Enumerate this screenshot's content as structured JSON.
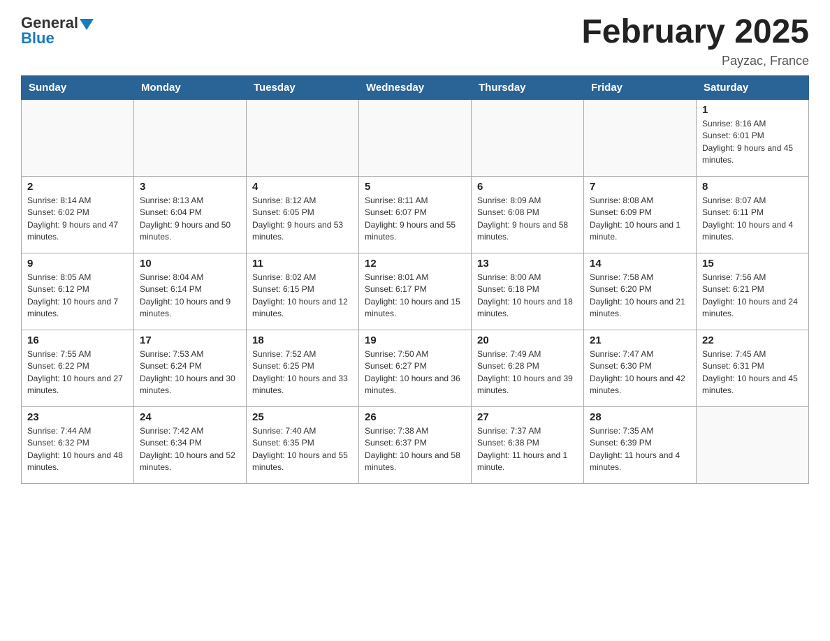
{
  "header": {
    "logo_text_general": "General",
    "logo_text_blue": "Blue",
    "title": "February 2025",
    "location": "Payzac, France"
  },
  "days_of_week": [
    "Sunday",
    "Monday",
    "Tuesday",
    "Wednesday",
    "Thursday",
    "Friday",
    "Saturday"
  ],
  "weeks": [
    [
      {
        "day": "",
        "info": ""
      },
      {
        "day": "",
        "info": ""
      },
      {
        "day": "",
        "info": ""
      },
      {
        "day": "",
        "info": ""
      },
      {
        "day": "",
        "info": ""
      },
      {
        "day": "",
        "info": ""
      },
      {
        "day": "1",
        "info": "Sunrise: 8:16 AM\nSunset: 6:01 PM\nDaylight: 9 hours and 45 minutes."
      }
    ],
    [
      {
        "day": "2",
        "info": "Sunrise: 8:14 AM\nSunset: 6:02 PM\nDaylight: 9 hours and 47 minutes."
      },
      {
        "day": "3",
        "info": "Sunrise: 8:13 AM\nSunset: 6:04 PM\nDaylight: 9 hours and 50 minutes."
      },
      {
        "day": "4",
        "info": "Sunrise: 8:12 AM\nSunset: 6:05 PM\nDaylight: 9 hours and 53 minutes."
      },
      {
        "day": "5",
        "info": "Sunrise: 8:11 AM\nSunset: 6:07 PM\nDaylight: 9 hours and 55 minutes."
      },
      {
        "day": "6",
        "info": "Sunrise: 8:09 AM\nSunset: 6:08 PM\nDaylight: 9 hours and 58 minutes."
      },
      {
        "day": "7",
        "info": "Sunrise: 8:08 AM\nSunset: 6:09 PM\nDaylight: 10 hours and 1 minute."
      },
      {
        "day": "8",
        "info": "Sunrise: 8:07 AM\nSunset: 6:11 PM\nDaylight: 10 hours and 4 minutes."
      }
    ],
    [
      {
        "day": "9",
        "info": "Sunrise: 8:05 AM\nSunset: 6:12 PM\nDaylight: 10 hours and 7 minutes."
      },
      {
        "day": "10",
        "info": "Sunrise: 8:04 AM\nSunset: 6:14 PM\nDaylight: 10 hours and 9 minutes."
      },
      {
        "day": "11",
        "info": "Sunrise: 8:02 AM\nSunset: 6:15 PM\nDaylight: 10 hours and 12 minutes."
      },
      {
        "day": "12",
        "info": "Sunrise: 8:01 AM\nSunset: 6:17 PM\nDaylight: 10 hours and 15 minutes."
      },
      {
        "day": "13",
        "info": "Sunrise: 8:00 AM\nSunset: 6:18 PM\nDaylight: 10 hours and 18 minutes."
      },
      {
        "day": "14",
        "info": "Sunrise: 7:58 AM\nSunset: 6:20 PM\nDaylight: 10 hours and 21 minutes."
      },
      {
        "day": "15",
        "info": "Sunrise: 7:56 AM\nSunset: 6:21 PM\nDaylight: 10 hours and 24 minutes."
      }
    ],
    [
      {
        "day": "16",
        "info": "Sunrise: 7:55 AM\nSunset: 6:22 PM\nDaylight: 10 hours and 27 minutes."
      },
      {
        "day": "17",
        "info": "Sunrise: 7:53 AM\nSunset: 6:24 PM\nDaylight: 10 hours and 30 minutes."
      },
      {
        "day": "18",
        "info": "Sunrise: 7:52 AM\nSunset: 6:25 PM\nDaylight: 10 hours and 33 minutes."
      },
      {
        "day": "19",
        "info": "Sunrise: 7:50 AM\nSunset: 6:27 PM\nDaylight: 10 hours and 36 minutes."
      },
      {
        "day": "20",
        "info": "Sunrise: 7:49 AM\nSunset: 6:28 PM\nDaylight: 10 hours and 39 minutes."
      },
      {
        "day": "21",
        "info": "Sunrise: 7:47 AM\nSunset: 6:30 PM\nDaylight: 10 hours and 42 minutes."
      },
      {
        "day": "22",
        "info": "Sunrise: 7:45 AM\nSunset: 6:31 PM\nDaylight: 10 hours and 45 minutes."
      }
    ],
    [
      {
        "day": "23",
        "info": "Sunrise: 7:44 AM\nSunset: 6:32 PM\nDaylight: 10 hours and 48 minutes."
      },
      {
        "day": "24",
        "info": "Sunrise: 7:42 AM\nSunset: 6:34 PM\nDaylight: 10 hours and 52 minutes."
      },
      {
        "day": "25",
        "info": "Sunrise: 7:40 AM\nSunset: 6:35 PM\nDaylight: 10 hours and 55 minutes."
      },
      {
        "day": "26",
        "info": "Sunrise: 7:38 AM\nSunset: 6:37 PM\nDaylight: 10 hours and 58 minutes."
      },
      {
        "day": "27",
        "info": "Sunrise: 7:37 AM\nSunset: 6:38 PM\nDaylight: 11 hours and 1 minute."
      },
      {
        "day": "28",
        "info": "Sunrise: 7:35 AM\nSunset: 6:39 PM\nDaylight: 11 hours and 4 minutes."
      },
      {
        "day": "",
        "info": ""
      }
    ]
  ]
}
